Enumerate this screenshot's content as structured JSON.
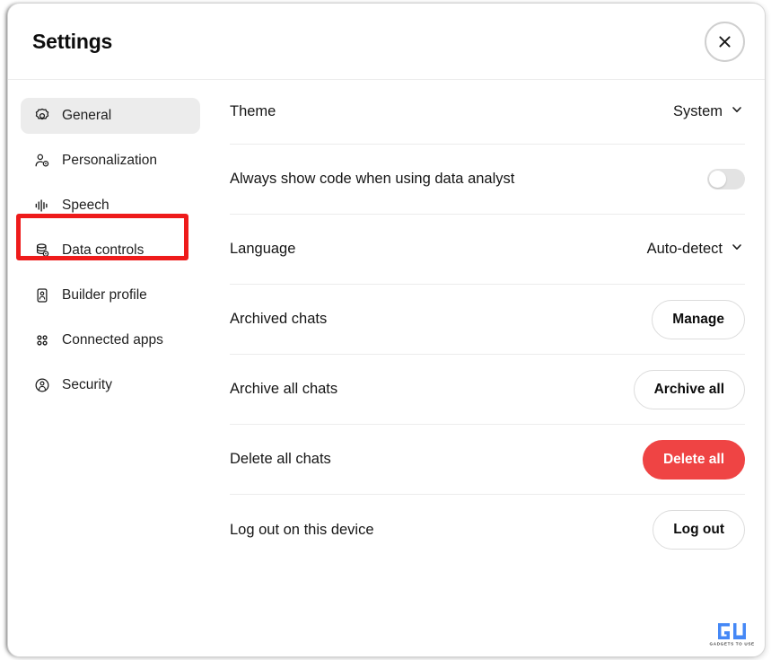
{
  "dialog": {
    "title": "Settings",
    "close_icon": "close-icon",
    "close_label": "Close"
  },
  "sidebar": {
    "items": [
      {
        "id": "general",
        "label": "General",
        "icon": "gear-icon",
        "active": true
      },
      {
        "id": "personalization",
        "label": "Personalization",
        "icon": "person-gear-icon",
        "active": false
      },
      {
        "id": "speech",
        "label": "Speech",
        "icon": "waveform-icon",
        "active": false
      },
      {
        "id": "data-controls",
        "label": "Data controls",
        "icon": "database-gear-icon",
        "active": false,
        "highlighted": true
      },
      {
        "id": "builder-profile",
        "label": "Builder profile",
        "icon": "id-card-icon",
        "active": false
      },
      {
        "id": "connected-apps",
        "label": "Connected apps",
        "icon": "grid-dots-icon",
        "active": false
      },
      {
        "id": "security",
        "label": "Security",
        "icon": "shield-person-icon",
        "active": false
      }
    ],
    "annotation": {
      "target": "Data controls",
      "color": "#ee1b1b"
    }
  },
  "main": {
    "rows": [
      {
        "id": "theme",
        "label": "Theme",
        "control": "dropdown",
        "value": "System"
      },
      {
        "id": "always-show-code",
        "label": "Always show code when using data analyst",
        "control": "toggle",
        "value": "off"
      },
      {
        "id": "language",
        "label": "Language",
        "control": "dropdown",
        "value": "Auto-detect"
      },
      {
        "id": "archived-chats",
        "label": "Archived chats",
        "control": "button",
        "value": "Manage"
      },
      {
        "id": "archive-all-chats",
        "label": "Archive all chats",
        "control": "button",
        "value": "Archive all"
      },
      {
        "id": "delete-all-chats",
        "label": "Delete all chats",
        "control": "button",
        "value": "Delete all",
        "style": "danger"
      },
      {
        "id": "log-out-device",
        "label": "Log out on this device",
        "control": "button",
        "value": "Log out"
      }
    ]
  },
  "watermark": {
    "mark": "GU",
    "caption": "GADGETS TO USE",
    "color": "#3b82f6"
  }
}
